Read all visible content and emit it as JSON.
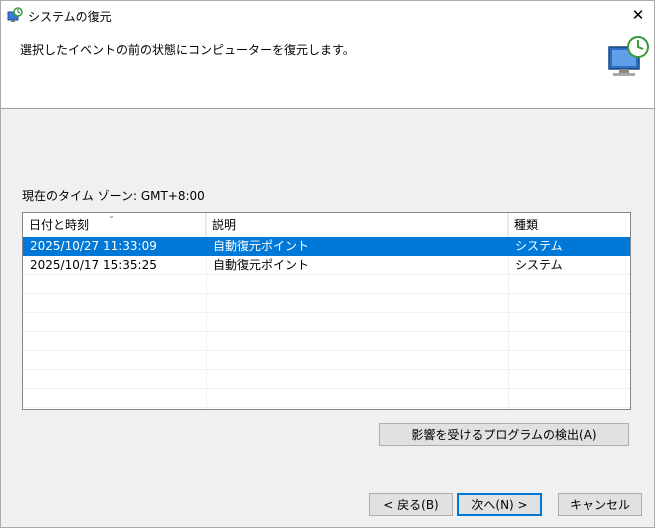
{
  "window": {
    "title": "システムの復元"
  },
  "header": {
    "instruction": "選択したイベントの前の状態にコンピューターを復元します。"
  },
  "timezone": {
    "label": "現在のタイム ゾーン: GMT+8:00"
  },
  "table": {
    "columns": [
      "日付と時刻",
      "説明",
      "種類"
    ],
    "rows": [
      {
        "date": "2025/10/27 11:33:09",
        "desc": "自動復元ポイント",
        "type": "システム",
        "selected": true
      },
      {
        "date": "2025/10/17 15:35:25",
        "desc": "自動復元ポイント",
        "type": "システム",
        "selected": false
      }
    ]
  },
  "buttons": {
    "scan": "影響を受けるプログラムの検出(A)",
    "back": "< 戻る(B)",
    "next": "次へ(N) >",
    "cancel": "キャンセル"
  },
  "icons": {
    "app": "system-restore-icon",
    "header": "monitor-restore-icon",
    "close": "close-icon"
  },
  "colors": {
    "selection": "#0078d7",
    "background": "#f0f0f0"
  }
}
